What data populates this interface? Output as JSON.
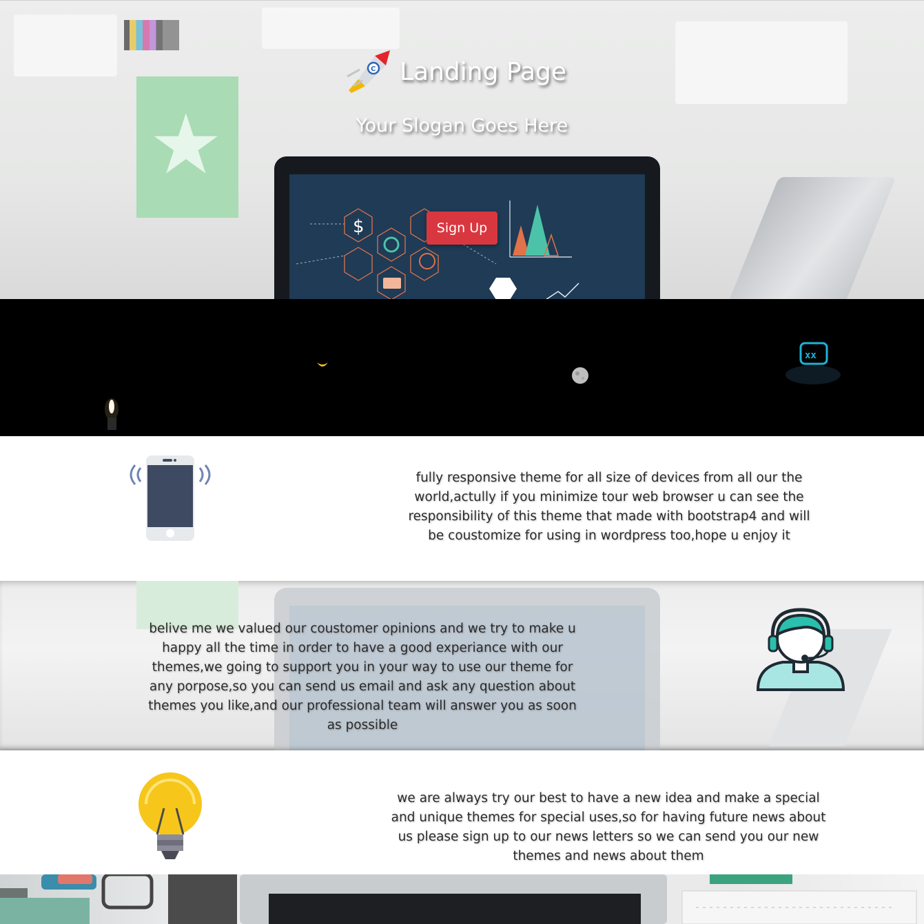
{
  "hero": {
    "brand_title": "Landing Page",
    "slogan": "Your Slogan Goes Here",
    "signup_label": "Sign Up"
  },
  "features": [
    {
      "icon": "smartphone-icon",
      "text": "fully responsive theme for all size of devices from all our the world,actully if you minimize tour web browser u can see the responsibility of this theme that made with bootstrap4 and will be coustomize for using in wordpress too,hope u enjoy it"
    },
    {
      "icon": "support-agent-icon",
      "text": "belive me we valued our coustomer opinions and we try to make u happy all the time in order to have a good experiance with our themes,we going to support you in your way to use our theme for any porpose,so you can send us email and ask any question about themes you like,and our professional team will answer you as soon as possible"
    },
    {
      "icon": "lightbulb-icon",
      "text": "we are always try our best to have a new idea and make a special and unique themes for special uses,so for having future news about us please sign up to our news letters so we can send you our new themes and news about them"
    }
  ],
  "colors": {
    "signup_button": "#d9373f",
    "laptop_screen": "#1f3b56",
    "dark_band": "#000000",
    "phone_body": "#3e4a61",
    "agent_accent": "#2bbfae",
    "bulb_yellow": "#f6c61b"
  }
}
